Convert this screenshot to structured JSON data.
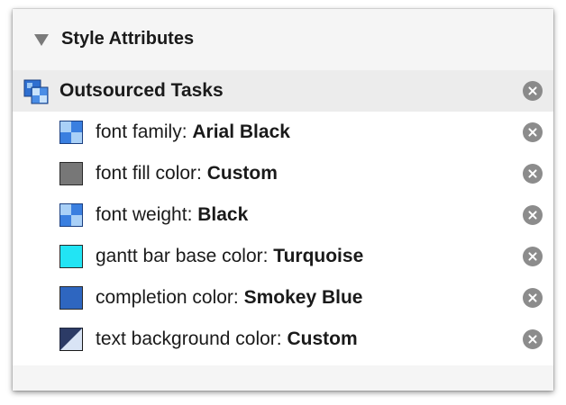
{
  "section": {
    "title": "Style Attributes",
    "expanded": true
  },
  "group": {
    "label": "Outsourced Tasks",
    "icon": "style-group-icon"
  },
  "attributes": [
    {
      "name": "font family: ",
      "value": "Arial Black",
      "icon": "font-style-icon"
    },
    {
      "name": "font fill color: ",
      "value": "Custom",
      "color": "#777777"
    },
    {
      "name": "font weight: ",
      "value": "Black",
      "icon": "font-style-icon"
    },
    {
      "name": "gantt bar base color: ",
      "value": "Turquoise",
      "color": "#22e4f4"
    },
    {
      "name": "completion color: ",
      "value": "Smokey Blue",
      "color": "#2e66c0"
    },
    {
      "name": "text background color: ",
      "value": "Custom",
      "icon": "split-color-icon"
    }
  ]
}
